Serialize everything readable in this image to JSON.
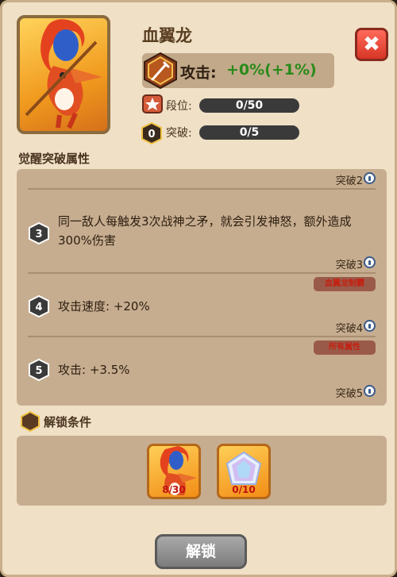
{
  "hero": {
    "name": "血翼龙"
  },
  "stats": {
    "attack_label": "攻击:",
    "attack_value": "+0%(+1%)",
    "rank_label": "段位:",
    "rank_value": "0/50",
    "rank_progress": 0,
    "breakthrough_badge": "0",
    "breakthrough_label": "突破:",
    "breakthrough_value": "0/5",
    "breakthrough_progress": 0
  },
  "awaken": {
    "section_title": "觉醒突破属性",
    "entries": [
      {
        "tag": "突破2"
      },
      {
        "num": "3",
        "text": "同一敌人每触发3次战神之矛，就会引发神怒，额外造成300%伤害",
        "tag": "突破3",
        "pill": "血翼龙制霸"
      },
      {
        "num": "4",
        "text": "攻击速度: +20%",
        "tag": "突破4",
        "pill": "所有属性"
      },
      {
        "num": "5",
        "text": "攻击: +3.5%",
        "tag": "突破5"
      }
    ]
  },
  "unlock": {
    "section_title": "解锁条件",
    "items": [
      {
        "count": "8/30",
        "icon": "dragon-shard-icon"
      },
      {
        "count": "0/10",
        "icon": "crystal-icon"
      }
    ],
    "button_label": "解锁"
  },
  "colors": {
    "panel_bg": "#efe0c6",
    "attr_bg": "#c7ad90",
    "accent_green": "#2a8a1a",
    "close_red": "#d63626"
  }
}
